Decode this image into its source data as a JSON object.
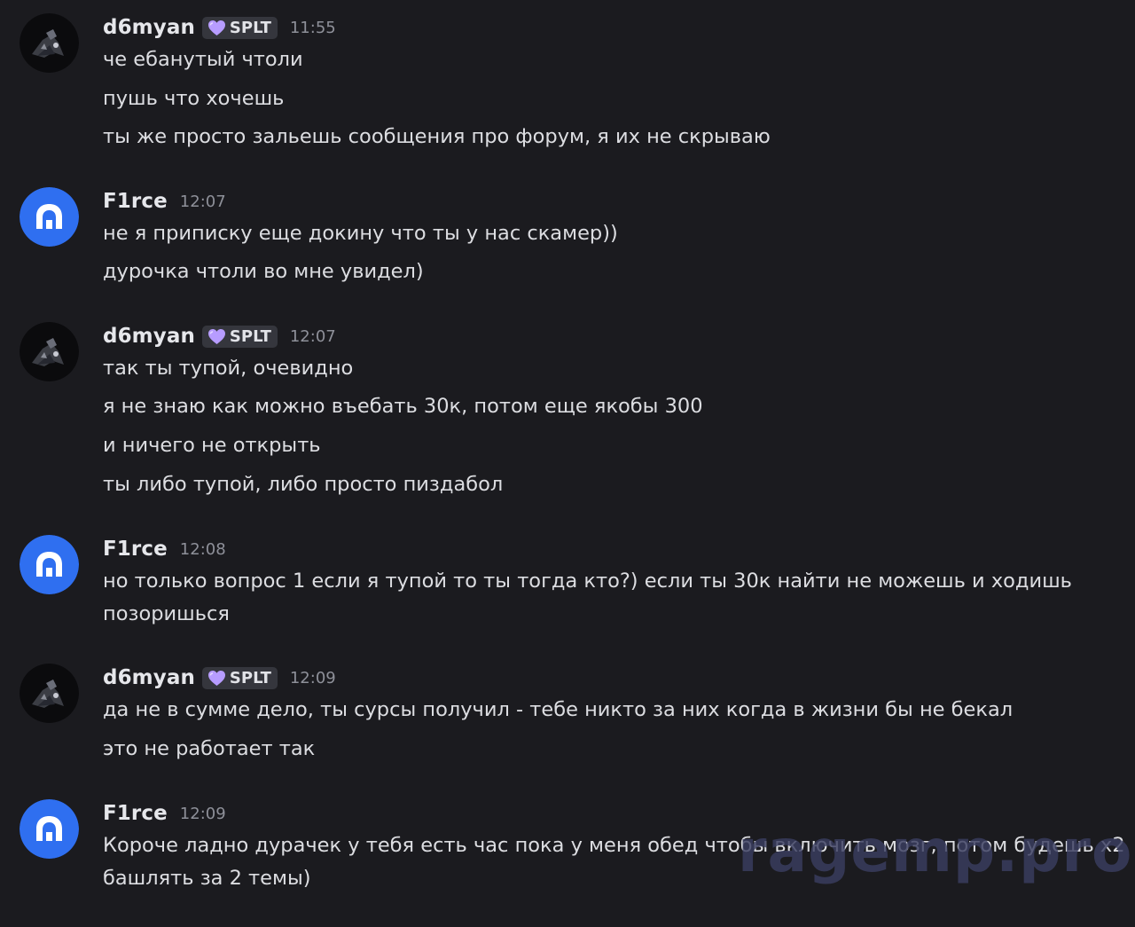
{
  "messages": [
    {
      "user": "d6myan",
      "badge": "SPLT",
      "time": "11:55",
      "lines": [
        "че ебанутый чтоли",
        "пушь что хочешь",
        "ты же просто зальешь сообщения про форум, я их не скрываю"
      ]
    },
    {
      "user": "F1rce",
      "time": "12:07",
      "lines": [
        "не я приписку еще докину что ты у нас скамер))",
        "дурочка чтоли во мне увидел)"
      ]
    },
    {
      "user": "d6myan",
      "badge": "SPLT",
      "time": "12:07",
      "lines": [
        "так ты тупой, очевидно",
        "я не знаю как можно въебать 30к, потом еще якобы 300",
        "и ничего не открыть",
        "ты либо тупой, либо просто пиздабол"
      ]
    },
    {
      "user": "F1rce",
      "time": "12:08",
      "lines": [
        "но только вопрос 1 если я тупой то ты тогда кто?) если ты 30к найти не можешь и ходишь",
        "позоришься"
      ]
    },
    {
      "user": "d6myan",
      "badge": "SPLT",
      "time": "12:09",
      "lines": [
        "да не в сумме дело, ты сурсы получил - тебе никто за них когда в жизни бы не бекал",
        "это не работает так"
      ]
    },
    {
      "user": "F1rce",
      "time": "12:09",
      "lines": [
        "Короче ладно дурачек у тебя есть час пока у меня обед чтобы включить мозг, потом будешь x2",
        "башлять за 2 темы)"
      ]
    }
  ],
  "watermark": "ragemp.pro",
  "colors": {
    "background": "#1b1b1f",
    "text": "#dcdde1",
    "timestamp": "#8e9099",
    "badge_bg": "#35363d",
    "heart": "#b79cff",
    "f1rce_avatar": "#2f6ff0"
  },
  "icons": {
    "badge": "heart-icon",
    "f1rce_avatar": "arch-logo-icon",
    "d6myan_avatar": "dark-figure-icon"
  }
}
